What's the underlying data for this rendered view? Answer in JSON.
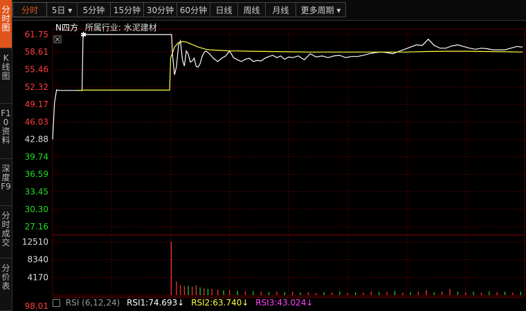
{
  "sidebar": {
    "tabs": [
      {
        "label": "分时图",
        "active": true
      },
      {
        "label": "K线图",
        "active": false
      },
      {
        "label": "F10资料",
        "active": false
      },
      {
        "label": "深度F9",
        "active": false
      },
      {
        "label": "分时成交",
        "active": false
      },
      {
        "label": "分价表",
        "active": false
      }
    ]
  },
  "toolbar": {
    "items": [
      {
        "label": "分时",
        "active": true
      },
      {
        "label": "5日 ▾",
        "active": false
      },
      {
        "label": "5分钟",
        "active": false
      },
      {
        "label": "15分钟",
        "active": false
      },
      {
        "label": "30分钟",
        "active": false
      },
      {
        "label": "60分钟",
        "active": false
      },
      {
        "label": "日线",
        "active": false
      },
      {
        "label": "周线",
        "active": false
      },
      {
        "label": "月线",
        "active": false
      },
      {
        "label": "更多周期 ▾",
        "active": false
      }
    ]
  },
  "stock": {
    "name": "N四方",
    "industry_label": "所属行业:",
    "industry": "水泥建材"
  },
  "colors": {
    "up": "#ff3b3b",
    "down": "#22dd22",
    "price_line": "#ffffff",
    "avg_line": "#ffff44",
    "grid": "#5a0000",
    "accent": "#e0541b",
    "rsi1": "#ffffff",
    "rsi2": "#ffff44",
    "rsi3": "#ff44ff"
  },
  "rsi": {
    "label": "RSI (6,12,24)",
    "rsi1": "RSI1:74.693↓",
    "rsi2": "RSI2:63.740↓",
    "rsi3": "RSI3:43.024↓",
    "axis_label": "98.01"
  },
  "chart_data": {
    "type": "line",
    "price_axis": {
      "ticks": [
        "61.75",
        "58.61",
        "55.46",
        "52.32",
        "49.17",
        "46.03",
        "42.88",
        "39.74",
        "36.59",
        "33.45",
        "30.30",
        "27.16"
      ],
      "ylim": [
        27.16,
        61.75
      ],
      "reference": 42.88
    },
    "volume_axis": {
      "ticks": [
        "12510",
        "8340",
        "4170"
      ],
      "ylim": [
        0,
        12510
      ]
    },
    "x_range": [
      0,
      240
    ],
    "series": [
      {
        "key": "price",
        "x": [
          0,
          1,
          2,
          3,
          12,
          13,
          14,
          15,
          15.5,
          60,
          60.5,
          61,
          62,
          63,
          64,
          65,
          66,
          67,
          68,
          69,
          70,
          71,
          72,
          73,
          74,
          75,
          76,
          77,
          78,
          80,
          82,
          84,
          86,
          88,
          90,
          92,
          94,
          96,
          98,
          100,
          102,
          104,
          106,
          108,
          110,
          112,
          114,
          116,
          118,
          120,
          122,
          125,
          128,
          131,
          134,
          137,
          140,
          143,
          146,
          149,
          152,
          155,
          158,
          161,
          164,
          167,
          170,
          173,
          176,
          179,
          182,
          185,
          188,
          191,
          194,
          197,
          200,
          203,
          206,
          209,
          212,
          215,
          218,
          221,
          224,
          227,
          230,
          233,
          236,
          239
        ],
        "values": [
          42.88,
          49.5,
          51.8,
          51.7,
          51.7,
          51.7,
          51.7,
          51.7,
          61.75,
          61.75,
          61.75,
          58.0,
          54.5,
          56.0,
          59.8,
          60.6,
          57.2,
          56.1,
          58.8,
          58.2,
          56.8,
          57.0,
          57.5,
          56.0,
          55.9,
          56.5,
          57.8,
          58.5,
          58.8,
          58.2,
          57.4,
          56.9,
          57.5,
          57.9,
          58.8,
          57.6,
          57.2,
          56.9,
          57.3,
          57.5,
          56.9,
          57.1,
          57.0,
          57.5,
          57.8,
          58.0,
          57.6,
          57.9,
          57.3,
          57.7,
          57.6,
          57.9,
          57.2,
          58.3,
          57.7,
          57.9,
          57.6,
          57.9,
          58.0,
          57.6,
          57.8,
          57.8,
          58.0,
          58.3,
          58.5,
          58.6,
          58.5,
          58.3,
          58.7,
          59.1,
          59.5,
          59.9,
          59.8,
          60.9,
          59.8,
          59.3,
          59.3,
          59.7,
          59.9,
          59.6,
          59.3,
          59.1,
          59.3,
          59.2,
          59.0,
          59.0,
          59.0,
          59.3,
          59.6,
          59.5
        ]
      },
      {
        "key": "avg",
        "x": [
          12,
          15,
          15.5,
          59.5,
          60,
          62,
          64,
          66,
          68,
          70,
          72,
          74,
          76,
          78,
          80,
          85,
          90,
          95,
          100,
          110,
          120,
          130,
          140,
          150,
          160,
          170,
          180,
          190,
          200,
          210,
          220,
          230,
          239
        ],
        "values": [
          51.7,
          51.7,
          51.75,
          51.75,
          57.5,
          59.5,
          60.3,
          60.5,
          60.4,
          60.1,
          59.8,
          59.5,
          59.3,
          59.1,
          59.0,
          58.9,
          58.8,
          58.8,
          58.75,
          58.7,
          58.65,
          58.6,
          58.6,
          58.6,
          58.6,
          58.6,
          58.6,
          58.7,
          58.75,
          58.75,
          58.7,
          58.65,
          58.6
        ]
      }
    ],
    "volume": {
      "x": [
        60.3,
        63,
        65,
        67,
        69,
        71,
        73,
        75,
        77,
        79,
        81,
        84,
        87,
        90,
        94,
        98,
        102,
        106,
        110,
        114,
        118,
        122,
        126,
        130,
        134,
        138,
        142,
        146,
        150,
        154,
        158,
        162,
        166,
        170,
        174,
        178,
        182,
        186,
        190,
        194,
        198,
        202,
        206,
        210,
        214,
        218,
        222,
        226,
        230,
        234,
        238
      ],
      "values": [
        12510,
        3200,
        2300,
        2100,
        2200,
        2000,
        2300,
        1800,
        1600,
        1500,
        1500,
        1300,
        1100,
        1200,
        1000,
        900,
        900,
        800,
        700,
        800,
        700,
        800,
        600,
        700,
        500,
        700,
        600,
        800,
        500,
        700,
        600,
        900,
        700,
        800,
        1000,
        600,
        700,
        800,
        1200,
        700,
        900,
        1500,
        800,
        700,
        800,
        600,
        900,
        700,
        800,
        600,
        800
      ],
      "up": [
        true,
        true,
        true,
        true,
        false,
        true,
        true,
        false,
        true,
        false,
        true,
        true,
        false,
        true,
        false,
        true,
        false,
        true,
        false,
        true,
        false,
        true,
        false,
        true,
        true,
        false,
        true,
        false,
        true,
        false,
        true,
        true,
        false,
        true,
        false,
        true,
        false,
        true,
        true,
        false,
        true,
        true,
        false,
        true,
        false,
        true,
        false,
        true,
        false,
        true,
        false
      ]
    }
  }
}
